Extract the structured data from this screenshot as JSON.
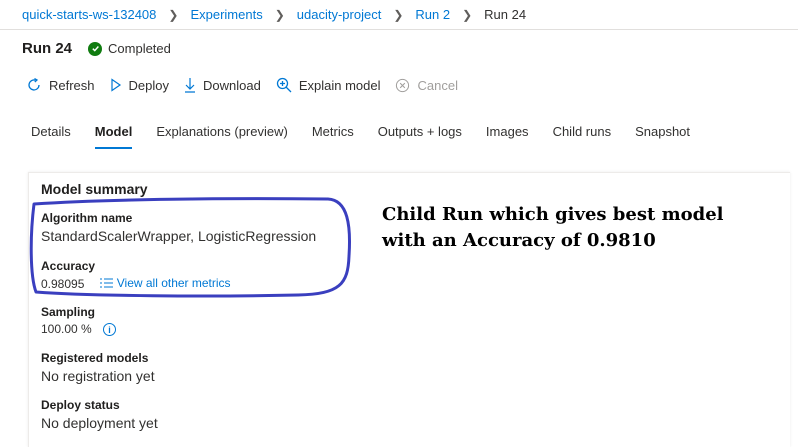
{
  "breadcrumb": {
    "items": [
      "quick-starts-ws-132408",
      "Experiments",
      "udacity-project",
      "Run 2"
    ],
    "current": "Run 24"
  },
  "header": {
    "title": "Run 24",
    "status": "Completed",
    "status_color": "#107c10"
  },
  "toolbar": {
    "refresh": "Refresh",
    "deploy": "Deploy",
    "download": "Download",
    "explain": "Explain model",
    "cancel": "Cancel"
  },
  "tabs": [
    "Details",
    "Model",
    "Explanations (preview)",
    "Metrics",
    "Outputs + logs",
    "Images",
    "Child runs",
    "Snapshot"
  ],
  "active_tab": "Model",
  "summary": {
    "title": "Model summary",
    "algorithm_label": "Algorithm name",
    "algorithm_value": "StandardScalerWrapper, LogisticRegression",
    "accuracy_label": "Accuracy",
    "accuracy_value": "0.98095",
    "metrics_link": "View all other metrics",
    "sampling_label": "Sampling",
    "sampling_value": "100.00 %",
    "registered_label": "Registered models",
    "registered_value": "No registration yet",
    "deploy_label": "Deploy status",
    "deploy_value": "No deployment yet"
  },
  "annotation": {
    "line1": "Child Run which gives best model",
    "line2": "with an Accuracy of 0.9810",
    "color": "#3a3fbf"
  },
  "colors": {
    "accent": "#0078d4",
    "success": "#107c10"
  }
}
